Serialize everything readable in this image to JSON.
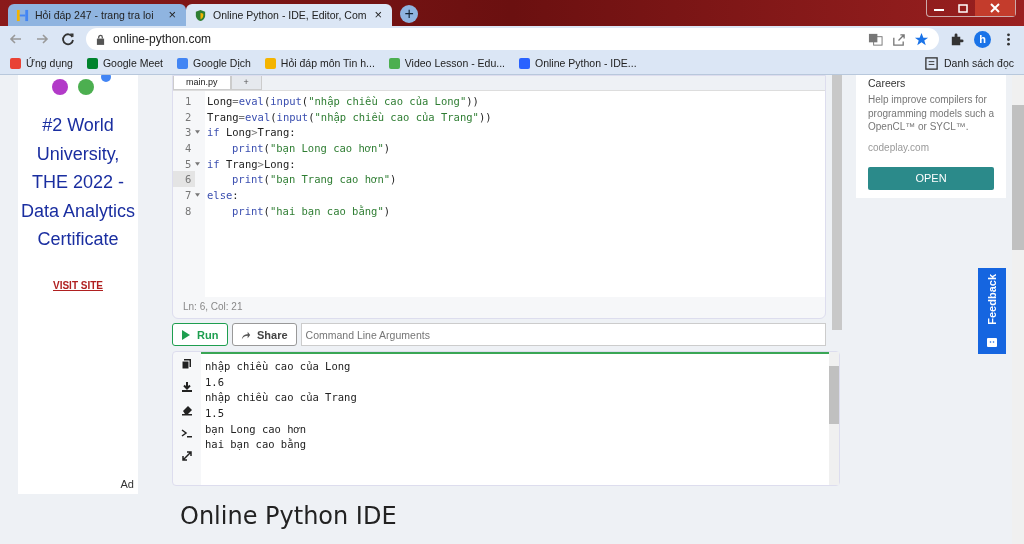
{
  "browser": {
    "tabs": [
      {
        "title": "Hỏi đáp 247 - trang tra loi",
        "selected": false,
        "close": "×"
      },
      {
        "title": "Online Python - IDE, Editor, Com",
        "selected": true,
        "close": "×"
      }
    ],
    "new_tab": "+",
    "url": "online-python.com",
    "profile": "h",
    "bookmarks": [
      {
        "label": "Ứng dụng",
        "color": "#e94235"
      },
      {
        "label": "Google Meet",
        "color": "#00832d"
      },
      {
        "label": "Google Dịch",
        "color": "#4285f4"
      },
      {
        "label": "Hỏi đáp môn Tin h...",
        "color": "#f4b400"
      },
      {
        "label": "Video Lesson - Edu...",
        "color": "#4caf50"
      },
      {
        "label": "Online Python - IDE...",
        "color": "#2962ff"
      }
    ],
    "reading_list": "Danh sách đọc"
  },
  "left_ad": {
    "headline": "#2 World University, THE 2022 - Data Analytics Certificate",
    "link": "VISIT SITE",
    "ad_label": "Ad"
  },
  "editor": {
    "tabs": [
      {
        "label": "main.py",
        "selected": true
      },
      {
        "label": "+",
        "selected": false
      }
    ],
    "lines": [
      {
        "no": "1",
        "fold": false,
        "current": false,
        "indented": false,
        "tokens": [
          {
            "text": "Long",
            "kind": "id"
          },
          {
            "text": "=",
            "kind": "op"
          },
          {
            "text": "eval",
            "kind": "fn"
          },
          {
            "text": "(",
            "kind": "id"
          },
          {
            "text": "input",
            "kind": "fn"
          },
          {
            "text": "(",
            "kind": "id"
          },
          {
            "text": "\"nhập chiều cao của Long\"",
            "kind": "str"
          },
          {
            "text": "))",
            "kind": "id"
          }
        ]
      },
      {
        "no": "2",
        "fold": false,
        "current": false,
        "indented": false,
        "tokens": [
          {
            "text": "Trang",
            "kind": "id"
          },
          {
            "text": "=",
            "kind": "op"
          },
          {
            "text": "eval",
            "kind": "fn"
          },
          {
            "text": "(",
            "kind": "id"
          },
          {
            "text": "input",
            "kind": "fn"
          },
          {
            "text": "(",
            "kind": "id"
          },
          {
            "text": "\"nhập chiều cao của Trang\"",
            "kind": "str"
          },
          {
            "text": "))",
            "kind": "id"
          }
        ]
      },
      {
        "no": "3",
        "fold": true,
        "current": false,
        "indented": false,
        "tokens": [
          {
            "text": "if",
            "kind": "kw"
          },
          {
            "text": " Long",
            "kind": "id"
          },
          {
            "text": ">",
            "kind": "op"
          },
          {
            "text": "Trang:",
            "kind": "id"
          }
        ]
      },
      {
        "no": "4",
        "fold": false,
        "current": false,
        "indented": true,
        "tokens": [
          {
            "text": "print",
            "kind": "fn"
          },
          {
            "text": "(",
            "kind": "id"
          },
          {
            "text": "\"bạn Long cao hơn\"",
            "kind": "str"
          },
          {
            "text": ")",
            "kind": "id"
          }
        ]
      },
      {
        "no": "5",
        "fold": true,
        "current": false,
        "indented": false,
        "tokens": [
          {
            "text": "if",
            "kind": "kw"
          },
          {
            "text": " Trang",
            "kind": "id"
          },
          {
            "text": ">",
            "kind": "op"
          },
          {
            "text": "Long:",
            "kind": "id"
          }
        ]
      },
      {
        "no": "6",
        "fold": false,
        "current": true,
        "indented": true,
        "tokens": [
          {
            "text": "print",
            "kind": "fn"
          },
          {
            "text": "(",
            "kind": "id"
          },
          {
            "text": "\"bạn Trang cao hơn\"",
            "kind": "str"
          },
          {
            "text": ")",
            "kind": "id"
          }
        ]
      },
      {
        "no": "7",
        "fold": true,
        "current": false,
        "indented": false,
        "tokens": [
          {
            "text": "else",
            "kind": "kw"
          },
          {
            "text": ":",
            "kind": "id"
          }
        ]
      },
      {
        "no": "8",
        "fold": false,
        "current": false,
        "indented": true,
        "tokens": [
          {
            "text": "print",
            "kind": "fn"
          },
          {
            "text": "(",
            "kind": "id"
          },
          {
            "text": "\"hai bạn cao bằng\"",
            "kind": "str"
          },
          {
            "text": ")",
            "kind": "id"
          }
        ]
      }
    ],
    "status": "Ln: 6,  Col: 21"
  },
  "actions": {
    "run": "Run",
    "share": "Share",
    "args_placeholder": "Command Line Arguments"
  },
  "output": [
    "nhập chiều cao của Long",
    "1.6",
    "nhập chiều cao của Trang",
    "1.5",
    "bạn Long cao hơn",
    "hai bạn cao bằng"
  ],
  "heading": "Online Python IDE",
  "right_ad": {
    "title": "Careers",
    "text": "Help improve compilers for programming models such a OpenCL™ or SYCL™.",
    "domain": "codeplay.com",
    "button": "OPEN"
  },
  "feedback": "Feedback"
}
